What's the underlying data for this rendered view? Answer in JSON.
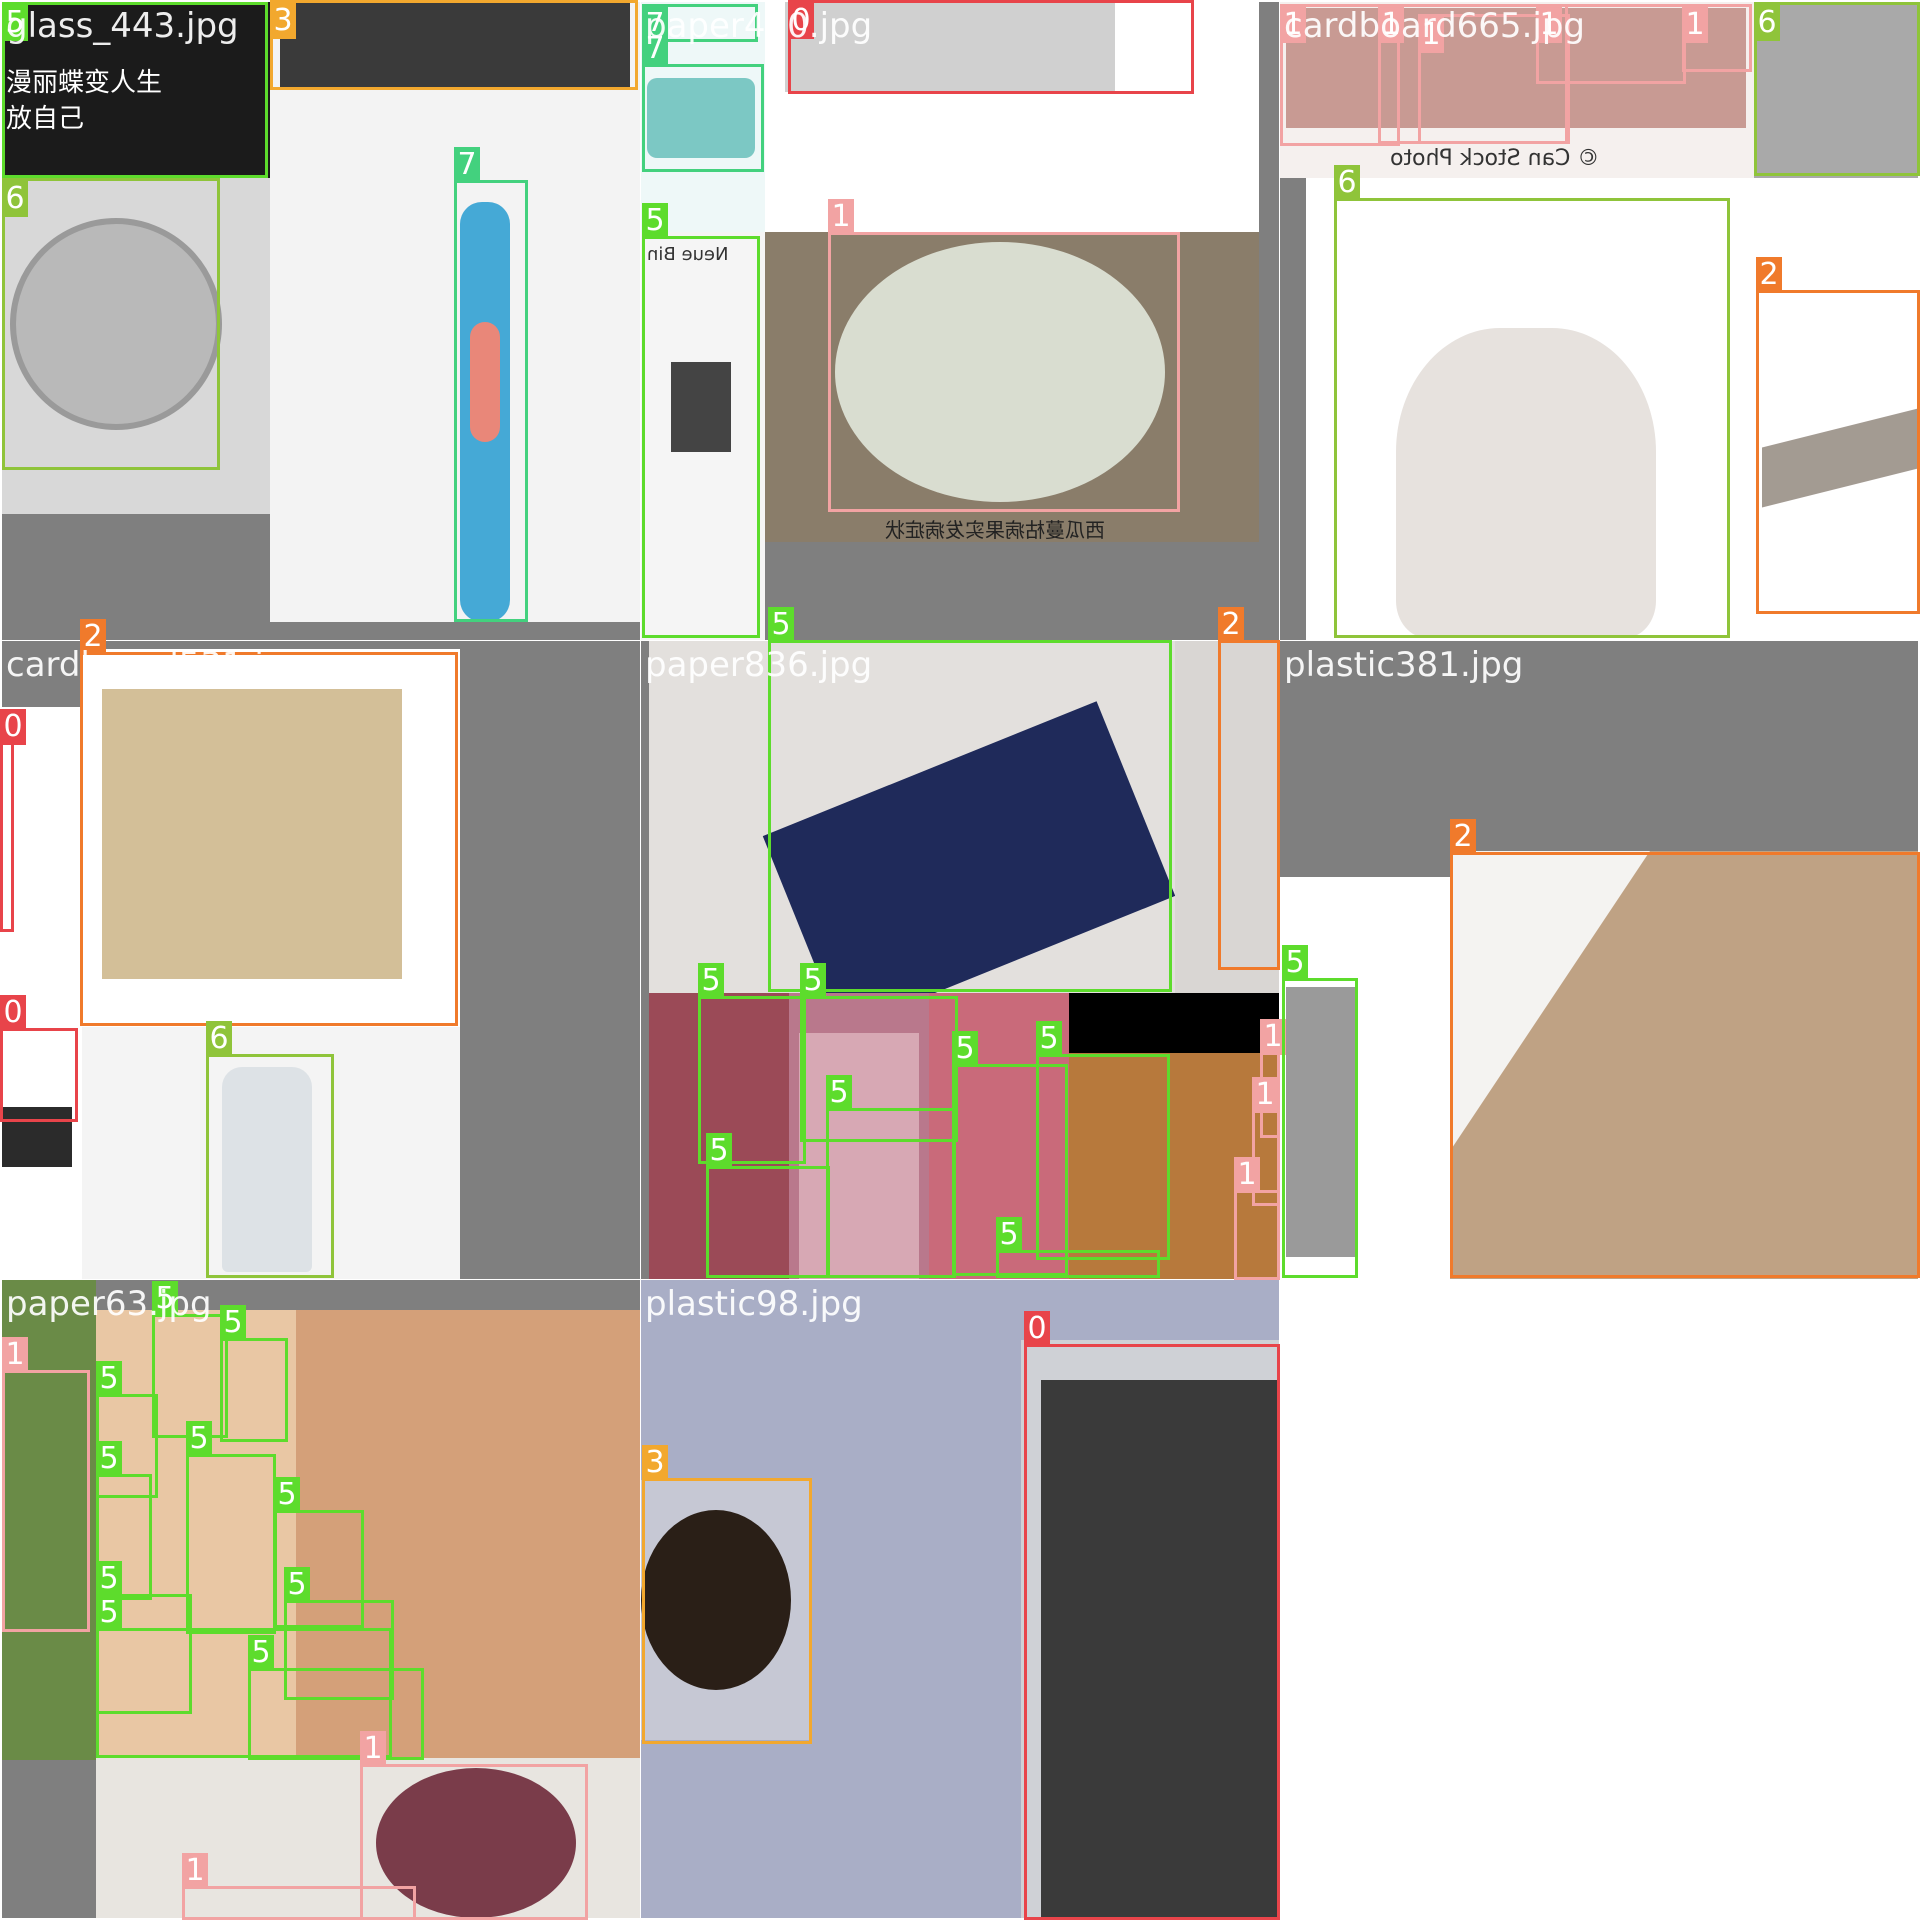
{
  "mosaic": {
    "tiles": [
      {
        "title": "glass_443.jpg"
      },
      {
        "title": "paper400.jpg"
      },
      {
        "title": "cardboard665.jpg"
      },
      {
        "title": "cardboard531.jpg"
      },
      {
        "title": "paper836.jpg"
      },
      {
        "title": "plastic381.jpg"
      },
      {
        "title": "paper63.jpg"
      },
      {
        "title": "plastic98.jpg"
      }
    ],
    "photo_text": {
      "glass_caption_line1": "漫丽蝶变人生",
      "glass_caption_line2": "放自己",
      "melon_caption": "西瓜蔓枯病果实发病症状",
      "stock_watermark": "© Can Stock Photo",
      "newspaper_head": "Neue Bin"
    }
  },
  "class_colors": {
    "0": "#e8444a",
    "1": "#f2a3a3",
    "2": "#f07a2b",
    "3": "#f2a82e",
    "5": "#5ddc2c",
    "6": "#8fc43a",
    "7": "#43d17e"
  },
  "boxes": [
    {
      "cls": "5"
    },
    {
      "cls": "3"
    },
    {
      "cls": "6"
    },
    {
      "cls": "7"
    },
    {
      "cls": "7"
    },
    {
      "cls": "7"
    },
    {
      "cls": "0"
    },
    {
      "cls": "5"
    },
    {
      "cls": "1"
    },
    {
      "cls": "1"
    },
    {
      "cls": "1"
    },
    {
      "cls": "1"
    },
    {
      "cls": "1"
    },
    {
      "cls": "1"
    },
    {
      "cls": "6"
    },
    {
      "cls": "6"
    },
    {
      "cls": "2"
    },
    {
      "cls": "2"
    },
    {
      "cls": "0"
    },
    {
      "cls": "0"
    },
    {
      "cls": "6"
    },
    {
      "cls": "5"
    },
    {
      "cls": "2"
    },
    {
      "cls": "5"
    },
    {
      "cls": "5"
    },
    {
      "cls": "5"
    },
    {
      "cls": "5"
    },
    {
      "cls": "5"
    },
    {
      "cls": "5"
    },
    {
      "cls": "5"
    },
    {
      "cls": "1"
    },
    {
      "cls": "1"
    },
    {
      "cls": "1"
    },
    {
      "cls": "2"
    },
    {
      "cls": "5"
    },
    {
      "cls": "1"
    },
    {
      "cls": "5"
    },
    {
      "cls": "5"
    },
    {
      "cls": "5"
    },
    {
      "cls": "5"
    },
    {
      "cls": "5"
    },
    {
      "cls": "5"
    },
    {
      "cls": "5"
    },
    {
      "cls": "5"
    },
    {
      "cls": "5"
    },
    {
      "cls": "5"
    },
    {
      "cls": "1"
    },
    {
      "cls": "1"
    },
    {
      "cls": "3"
    },
    {
      "cls": "0"
    }
  ]
}
